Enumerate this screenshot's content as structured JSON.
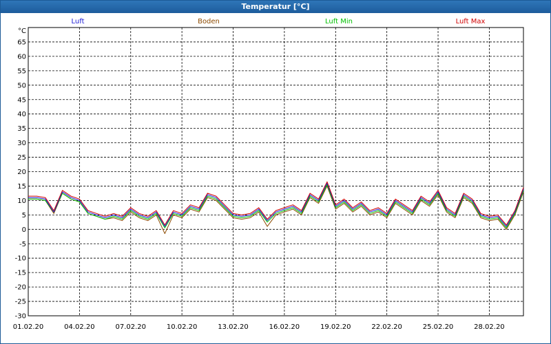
{
  "window": {
    "title": "Temperatur [°C]"
  },
  "chart_data": {
    "type": "line",
    "ylabel": "°C",
    "ylim": [
      -30,
      70
    ],
    "y_ticks": [
      -30,
      -25,
      -20,
      -15,
      -10,
      -5,
      0,
      5,
      10,
      15,
      20,
      25,
      30,
      35,
      40,
      45,
      50,
      55,
      60,
      65
    ],
    "xlim": [
      0,
      29
    ],
    "x_ticks": [
      0,
      3,
      6,
      9,
      12,
      15,
      18,
      21,
      24,
      27
    ],
    "x_tick_labels": [
      "01.02.20",
      "04.02.20",
      "07.02.20",
      "10.02.20",
      "13.02.20",
      "16.02.20",
      "19.02.20",
      "22.02.20",
      "25.02.20",
      "28.02.20"
    ],
    "grid": true,
    "legend_position": "top",
    "colors": {
      "luft": "#1b1bd6",
      "boden": "#8c4a00",
      "luft_min": "#00c000",
      "luft_max": "#d00000"
    },
    "series": [
      {
        "name": "Luft",
        "x": [
          0,
          0.5,
          1,
          1.5,
          2,
          2.5,
          3,
          3.5,
          4,
          4.5,
          5,
          5.5,
          6,
          6.5,
          7,
          7.5,
          8,
          8.5,
          9,
          9.5,
          10,
          10.5,
          11,
          11.5,
          12,
          12.5,
          13,
          13.5,
          14,
          14.5,
          15,
          15.5,
          16,
          16.5,
          17,
          17.5,
          18,
          18.5,
          19,
          19.5,
          20,
          20.5,
          21,
          21.5,
          22,
          22.5,
          23,
          23.5,
          24,
          24.5,
          25,
          25.5,
          26,
          26.5,
          27,
          27.5,
          28,
          28.5,
          29
        ],
        "values": [
          11,
          11,
          10.5,
          6,
          13,
          11,
          10,
          6,
          5,
          4,
          5,
          4,
          7,
          5,
          4,
          6,
          1,
          6,
          5,
          8,
          7,
          12,
          11,
          8,
          5,
          4.5,
          5,
          7,
          3,
          6,
          7,
          8,
          6,
          12,
          10,
          16,
          8,
          10,
          7,
          9,
          6,
          7,
          5,
          10,
          8,
          6,
          11,
          9,
          13,
          7,
          5,
          12,
          10,
          5,
          4,
          4.5,
          1,
          6,
          14
        ]
      },
      {
        "name": "Boden",
        "x": [
          0,
          0.5,
          1,
          1.5,
          2,
          2.5,
          3,
          3.5,
          4,
          4.5,
          5,
          5.5,
          6,
          6.5,
          7,
          7.5,
          8,
          8.5,
          9,
          9.5,
          10,
          10.5,
          11,
          11.5,
          12,
          12.5,
          13,
          13.5,
          14,
          14.5,
          15,
          15.5,
          16,
          16.5,
          17,
          17.5,
          18,
          18.5,
          19,
          19.5,
          20,
          20.5,
          21,
          21.5,
          22,
          22.5,
          23,
          23.5,
          24,
          24.5,
          25,
          25.5,
          26,
          26.5,
          27,
          27.5,
          28,
          28.5,
          29
        ],
        "values": [
          10.5,
          10.5,
          10,
          5.5,
          12.5,
          10.5,
          9.5,
          5.5,
          4.5,
          3.5,
          4,
          3,
          6,
          4,
          3,
          5,
          -1.5,
          5,
          4,
          7,
          6,
          11,
          10,
          7,
          4,
          3.5,
          4,
          6,
          1,
          5,
          6,
          7,
          5,
          11,
          9,
          15,
          7,
          9,
          6,
          8,
          5,
          6,
          4,
          9,
          7,
          5,
          10,
          8,
          12,
          6,
          4,
          11,
          9,
          4,
          3,
          3.5,
          0,
          5,
          13
        ]
      },
      {
        "name": "Luft Min",
        "x": [
          0,
          0.5,
          1,
          1.5,
          2,
          2.5,
          3,
          3.5,
          4,
          4.5,
          5,
          5.5,
          6,
          6.5,
          7,
          7.5,
          8,
          8.5,
          9,
          9.5,
          10,
          10.5,
          11,
          11.5,
          12,
          12.5,
          13,
          13.5,
          14,
          14.5,
          15,
          15.5,
          16,
          16.5,
          17,
          17.5,
          18,
          18.5,
          19,
          19.5,
          20,
          20.5,
          21,
          21.5,
          22,
          22.5,
          23,
          23.5,
          24,
          24.5,
          25,
          25.5,
          26,
          26.5,
          27,
          27.5,
          28,
          28.5,
          29
        ],
        "values": [
          10.5,
          10.5,
          10,
          6,
          12.5,
          10.5,
          9.5,
          5.5,
          4.5,
          3.5,
          4.5,
          3.5,
          6.5,
          4.5,
          3.5,
          5.5,
          0.5,
          5.5,
          4.5,
          7.5,
          6.5,
          11.5,
          10.5,
          7.5,
          4.5,
          4,
          4.5,
          6.5,
          2.5,
          5.5,
          6.5,
          7.5,
          5.5,
          11.5,
          9.5,
          15.5,
          7.5,
          9.5,
          6.5,
          8.5,
          5.5,
          6.5,
          4.5,
          9.5,
          7.5,
          5.5,
          10.5,
          8.5,
          12.5,
          6.5,
          4.5,
          11.5,
          9.5,
          4.5,
          3.5,
          4,
          0.5,
          5.5,
          13.5
        ]
      },
      {
        "name": "Luft Max",
        "x": [
          0,
          0.5,
          1,
          1.5,
          2,
          2.5,
          3,
          3.5,
          4,
          4.5,
          5,
          5.5,
          6,
          6.5,
          7,
          7.5,
          8,
          8.5,
          9,
          9.5,
          10,
          10.5,
          11,
          11.5,
          12,
          12.5,
          13,
          13.5,
          14,
          14.5,
          15,
          15.5,
          16,
          16.5,
          17,
          17.5,
          18,
          18.5,
          19,
          19.5,
          20,
          20.5,
          21,
          21.5,
          22,
          22.5,
          23,
          23.5,
          24,
          24.5,
          25,
          25.5,
          26,
          26.5,
          27,
          27.5,
          28,
          28.5,
          29
        ],
        "values": [
          11.5,
          11.5,
          11,
          6.5,
          13.5,
          11.5,
          10.5,
          6.5,
          5.5,
          4.5,
          5.5,
          4.5,
          7.5,
          5.5,
          4.5,
          6.5,
          1.5,
          6.5,
          5.5,
          8.5,
          7.5,
          12.5,
          11.5,
          8.5,
          5.5,
          5,
          5.5,
          7.5,
          3.5,
          6.5,
          7.5,
          8.5,
          6.5,
          12.5,
          10.5,
          16.5,
          8.5,
          10.5,
          7.5,
          9.5,
          6.5,
          7.5,
          5.5,
          10.5,
          8.5,
          6.5,
          11.5,
          9.5,
          13.5,
          7.5,
          5.5,
          12.5,
          10.5,
          5.5,
          4.5,
          5,
          1.5,
          6.5,
          14.5
        ]
      }
    ]
  }
}
